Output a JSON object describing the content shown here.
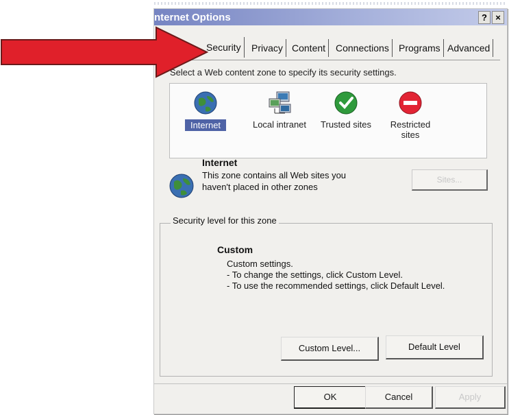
{
  "window": {
    "title": "nternet Options",
    "help_glyph": "?",
    "close_glyph": "×"
  },
  "tabs": [
    {
      "label": "Security",
      "active": true
    },
    {
      "label": "Privacy",
      "active": false
    },
    {
      "label": "Content",
      "active": false
    },
    {
      "label": "Connections",
      "active": false
    },
    {
      "label": "Programs",
      "active": false
    },
    {
      "label": "Advanced",
      "active": false
    }
  ],
  "instruction": "Select a Web content zone to specify its security settings.",
  "zones": [
    {
      "label": "Internet",
      "icon": "globe-icon",
      "selected": true
    },
    {
      "label": "Local intranet",
      "icon": "network-computer-icon",
      "selected": false
    },
    {
      "label": "Trusted sites",
      "icon": "checkmark-icon",
      "selected": false
    },
    {
      "label_line1": "Restricted",
      "label_line2": "sites",
      "icon": "no-entry-icon",
      "selected": false
    }
  ],
  "zone_info": {
    "name": "Internet",
    "desc_line1": "This zone contains all Web sites you",
    "desc_line2": "haven't placed in other zones",
    "sites_button": "Sites..."
  },
  "security_level": {
    "legend": "Security level for this zone",
    "title": "Custom",
    "lines": [
      "Custom settings.",
      "- To change the settings, click Custom Level.",
      "- To use the recommended settings, click Default Level."
    ],
    "custom_level_button": "Custom Level...",
    "default_level_button": "Default Level"
  },
  "footer": {
    "ok": "OK",
    "cancel": "Cancel",
    "apply": "Apply"
  },
  "annotation": {
    "arrow_color": "#e0202a",
    "arrow_outline": "#6a1a1a"
  },
  "colors": {
    "titlebar": "#7684c2",
    "selection": "#4f63a6",
    "dialog_bg": "#f1f0ed"
  }
}
